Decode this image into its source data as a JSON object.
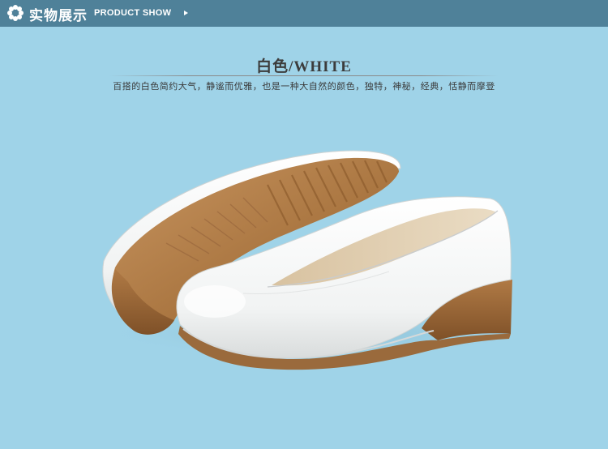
{
  "header": {
    "title_cn": "实物展示",
    "title_en": "PRODUCT SHOW",
    "icon": "flower-icon",
    "arrow_icon": "arrow-right-icon",
    "bar_color": "#4f8199"
  },
  "product": {
    "color_title": "白色/WHITE",
    "description": "百搭的白色简约大气，静谧而优雅，也是一种大自然的颜色，独特，神秘，经典，恬静而摩登"
  },
  "photo": {
    "subject": "white-wedge-pumps-photo",
    "background_color": "#9fd3e8",
    "shoe_color": "#ffffff",
    "sole_color": "#b07a45"
  }
}
